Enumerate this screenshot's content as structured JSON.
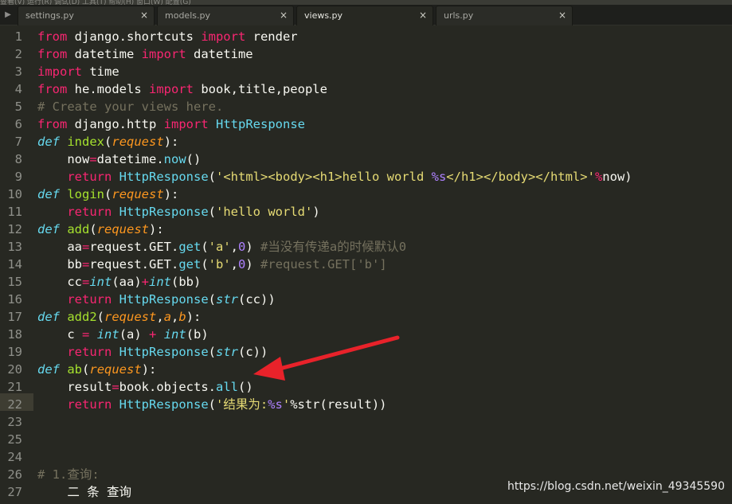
{
  "tabs": [
    {
      "label": "settings.py",
      "active": false
    },
    {
      "label": "models.py",
      "active": false
    },
    {
      "label": "views.py",
      "active": true
    },
    {
      "label": "urls.py",
      "active": false
    }
  ],
  "tab_close_glyph": "×",
  "tab_nav_glyph": "▶",
  "top_strip_text": "查看(V) 运行(R) 调试(D) 工具(T) 帮助(H) 窗口(W) 配置(G)",
  "line_numbers": [
    "1",
    "2",
    "3",
    "4",
    "5",
    "6",
    "7",
    "8",
    "9",
    "10",
    "11",
    "12",
    "13",
    "14",
    "15",
    "16",
    "17",
    "18",
    "19",
    "20",
    "21",
    "22",
    "23",
    "24",
    "25",
    "26",
    "27"
  ],
  "code_lines": [
    "from django.shortcuts import render",
    "from datetime import datetime",
    "import time",
    "from he.models import book,title,people",
    "# Create your views here.",
    "from django.http import HttpResponse",
    "def index(request):",
    "    now=datetime.now()",
    "    return HttpResponse('<html><body><h1>hello world %s</h1></body></html>'%now)",
    "def login(request):",
    "    return HttpResponse('hello world')",
    "def add(request):",
    "    aa=request.GET.get('a',0) #当没有传递a的时候默认0",
    "    bb=request.GET.get('b',0) #request.GET['b']",
    "    cc=int(aa)+int(bb)",
    "    return HttpResponse(str(cc))",
    "def add2(request,a,b):",
    "    c = int(a) + int(b)",
    "    return HttpResponse(str(c))",
    "def ab(request):",
    "    result=book.objects.all()",
    "    return HttpResponse('结果为:%s'%str(result))",
    "",
    "",
    "",
    "# 1.查询:",
    "    二 条 查询"
  ],
  "current_line": "22",
  "watermark": "https://blog.csdn.net/weixin_49345590",
  "colors": {
    "background": "#272822",
    "keyword": "#f92672",
    "function": "#a6e22e",
    "string": "#e6db74",
    "number": "#ae81ff",
    "comment": "#75715e",
    "builtin": "#66d9ef",
    "argument": "#fd971f",
    "arrow": "#e8222a"
  },
  "icons": {
    "arrow": "red-annotation-arrow-icon"
  }
}
